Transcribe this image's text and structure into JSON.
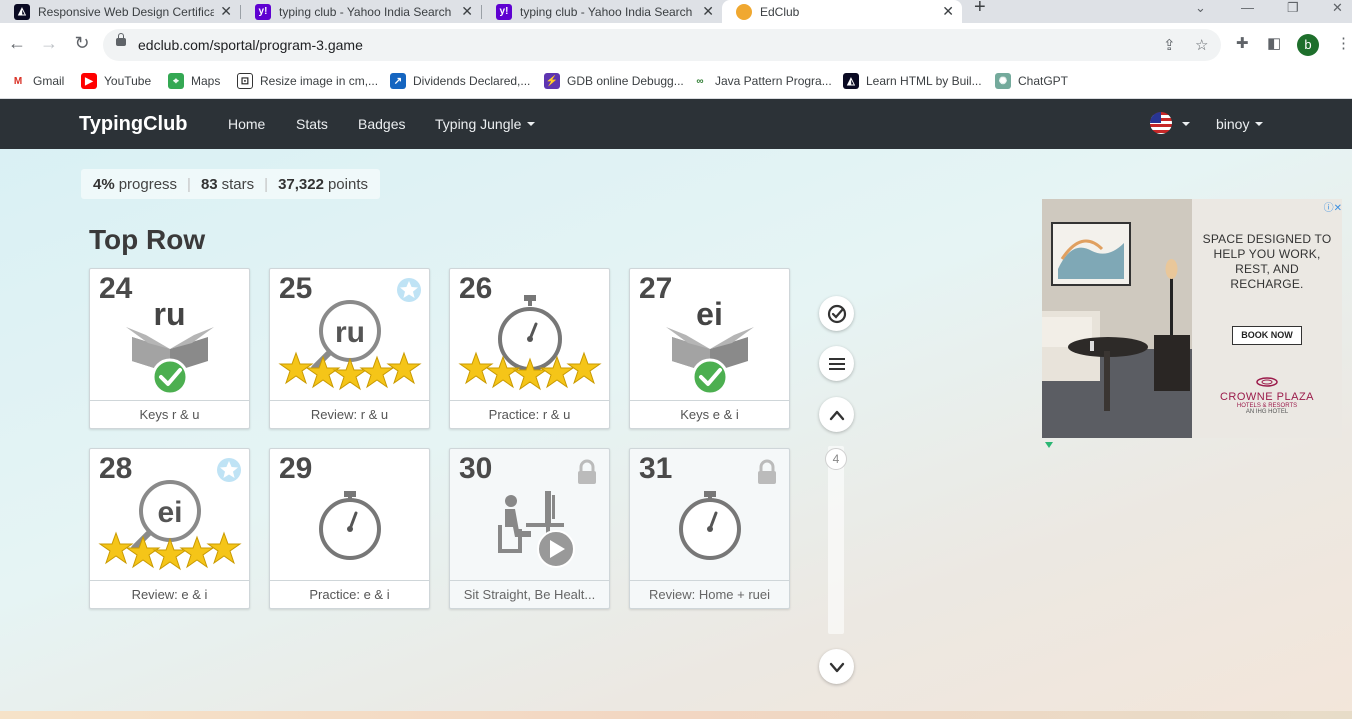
{
  "browser": {
    "tabs": [
      {
        "title": "Responsive Web Design Certificat",
        "icon": "fcc-icon"
      },
      {
        "title": "typing club - Yahoo India Search",
        "icon": "yahoo-icon"
      },
      {
        "title": "typing club - Yahoo India Search",
        "icon": "yahoo-icon"
      },
      {
        "title": "EdClub",
        "icon": "edclub-icon",
        "active": true
      }
    ],
    "url": "edclub.com/sportal/program-3.game",
    "profile_initial": "b",
    "bookmarks": [
      {
        "label": "Gmail",
        "icon": "gmail-icon"
      },
      {
        "label": "YouTube",
        "icon": "youtube-icon"
      },
      {
        "label": "Maps",
        "icon": "maps-icon"
      },
      {
        "label": "Resize image in cm,...",
        "icon": "resize-icon"
      },
      {
        "label": "Dividends Declared,...",
        "icon": "dividends-icon"
      },
      {
        "label": "GDB online Debugg...",
        "icon": "gdb-icon"
      },
      {
        "label": "Java Pattern Progra...",
        "icon": "java-icon"
      },
      {
        "label": "Learn HTML by Buil...",
        "icon": "fcc-icon"
      },
      {
        "label": "ChatGPT",
        "icon": "chatgpt-icon"
      }
    ]
  },
  "site": {
    "brand": "TypingClub",
    "nav": {
      "home": "Home",
      "stats": "Stats",
      "badges": "Badges",
      "jungle": "Typing Jungle"
    },
    "user": "binoy"
  },
  "stats": {
    "progress_value": "4%",
    "progress_label": "progress",
    "stars_value": "83",
    "stars_label": "stars",
    "points_value": "37,322",
    "points_label": "points"
  },
  "section_title": "Top Row",
  "lessons": [
    {
      "num": "24",
      "title": "Keys r & u",
      "text": "ru",
      "type": "keys",
      "state": "completed"
    },
    {
      "num": "25",
      "title": "Review: r & u",
      "text": "ru",
      "type": "review",
      "stars": 5,
      "badge": true
    },
    {
      "num": "26",
      "title": "Practice: r & u",
      "text": "",
      "type": "practice",
      "stars": 5
    },
    {
      "num": "27",
      "title": "Keys e & i",
      "text": "ei",
      "type": "keys",
      "state": "completed"
    },
    {
      "num": "28",
      "title": "Review: e & i",
      "text": "ei",
      "type": "review",
      "stars": 5,
      "badge": true
    },
    {
      "num": "29",
      "title": "Practice: e & i",
      "text": "",
      "type": "practice",
      "stars": 0
    },
    {
      "num": "30",
      "title": "Sit Straight, Be Healt...",
      "text": "",
      "type": "video",
      "locked": true
    },
    {
      "num": "31",
      "title": "Review: Home + ruei",
      "text": "",
      "type": "practice",
      "locked": true
    }
  ],
  "scroll_page": "4",
  "ad": {
    "headline": "SPACE DESIGNED TO HELP YOU WORK, REST, AND RECHARGE.",
    "button": "BOOK NOW",
    "brand": "CROWNE PLAZA",
    "brand_sub": "HOTELS & RESORTS",
    "brand_tag": "AN IHG HOTEL"
  }
}
